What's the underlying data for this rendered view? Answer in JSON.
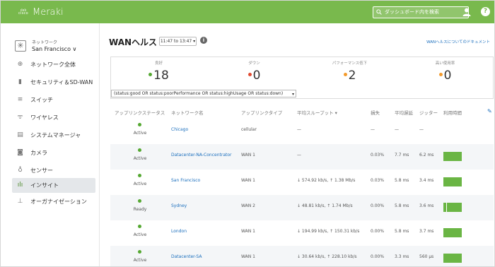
{
  "header": {
    "brand_small": "cisco",
    "brand": "Meraki",
    "search_placeholder": "ダッシュボード内を検索"
  },
  "sidebar": {
    "network_label": "ネットワーク",
    "network_value": "San Francisco ∨",
    "items": [
      {
        "label": "ネットワーク全体",
        "icon": "network-icon"
      },
      {
        "label": "セキュリティ＆SD-WAN",
        "icon": "security-icon"
      },
      {
        "label": "スイッチ",
        "icon": "switch-icon"
      },
      {
        "label": "ワイヤレス",
        "icon": "wireless-icon"
      },
      {
        "label": "システムマネージャ",
        "icon": "systems-manager-icon"
      },
      {
        "label": "カメラ",
        "icon": "camera-icon"
      },
      {
        "label": "センサー",
        "icon": "sensor-icon"
      },
      {
        "label": "インサイト",
        "icon": "insight-icon",
        "active": true
      },
      {
        "label": "オーガナイゼーション",
        "icon": "organization-icon"
      }
    ]
  },
  "main": {
    "title": "WANヘルス",
    "time_range": "11:47 to 13:47 ▾",
    "docs_link": "WANヘルスについてのドキュメント",
    "summary": [
      {
        "label": "良好",
        "value": "18",
        "color": "#55a832"
      },
      {
        "label": "ダウン",
        "value": "0",
        "color": "#e0492f"
      },
      {
        "label": "パフォーマンス低下",
        "value": "2",
        "color": "#f39a2b"
      },
      {
        "label": "高い使用率",
        "value": "0",
        "color": "#f39a2b"
      }
    ],
    "filter": "(status:good OR status:poorPerformance OR status:highUsage OR status:down)",
    "columns": [
      "アップリンクステータス",
      "ネットワーク名",
      "アップリンクタイプ",
      "平均スループット ▾",
      "損失",
      "平均遅延",
      "ジッター",
      "利用時間"
    ],
    "rows": [
      {
        "status": "Active",
        "network": "Chicago",
        "type": "cellular",
        "throughput": "—",
        "loss": "—",
        "latency": "—",
        "jitter": "—",
        "usage": false
      },
      {
        "status": "Active",
        "network": "Datacenter-NA-Concentrator",
        "type": "WAN 1",
        "throughput": "—",
        "loss": "0.03%",
        "latency": "7.7 ms",
        "jitter": "6.2 ms",
        "usage": true
      },
      {
        "status": "Active",
        "network": "San Francisco",
        "type": "WAN 1",
        "throughput": "↓ 574.92 kb/s, ↑ 1.38 Mb/s",
        "loss": "0.03%",
        "latency": "5.8 ms",
        "jitter": "3.4 ms",
        "usage": true
      },
      {
        "status": "Ready",
        "network": "Sydney",
        "type": "WAN 2",
        "throughput": "↓ 48.81 kb/s, ↑ 1.74 Mb/s",
        "loss": "0.00%",
        "latency": "5.8 ms",
        "jitter": "3.6 ms",
        "usage": true
      },
      {
        "status": "Active",
        "network": "London",
        "type": "WAN 1",
        "throughput": "↓ 194.99 kb/s, ↑ 150.31 kb/s",
        "loss": "0.00%",
        "latency": "5.8 ms",
        "jitter": "3.7 ms",
        "usage": true
      },
      {
        "status": "Active",
        "network": "Datacenter-SA",
        "type": "WAN 1",
        "throughput": "↓ 30.64 kb/s, ↑ 228.10 kb/s",
        "loss": "0.00%",
        "latency": "3.3 ms",
        "jitter": "560 μs",
        "usage": true
      }
    ]
  }
}
